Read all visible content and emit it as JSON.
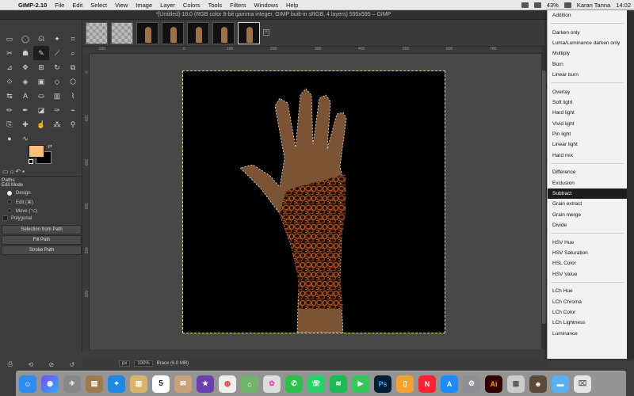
{
  "menubar": {
    "app_name": "GIMP-2.10",
    "items": [
      "File",
      "Edit",
      "Select",
      "View",
      "Image",
      "Layer",
      "Colors",
      "Tools",
      "Filters",
      "Windows",
      "Help"
    ],
    "battery": "43%",
    "user": "Karan Tanna",
    "time": "14:02"
  },
  "window": {
    "title": "*[Untitled]-18.0 (RGB color 8-bit gamma integer, GIMP built-in sRGB, 4 layers) 595x595 – GIMP"
  },
  "toolbox": {
    "foreground_color": "#ffbc7a",
    "background_color": "#000000",
    "tool_options": {
      "title": "Paths",
      "subtitle": "Edit Mode",
      "modes": [
        "Design",
        "Edit (⌘)",
        "Move (⌥)"
      ],
      "selected_mode": "Design",
      "polygonal_label": "Polygonal",
      "buttons": [
        "Selection from Path",
        "Fill Path",
        "Stroke Path"
      ]
    }
  },
  "rulers": {
    "h_ticks": [
      "-100",
      "0",
      "100",
      "200",
      "300",
      "400",
      "500",
      "600",
      "700"
    ],
    "v_ticks": [
      "0",
      "100",
      "200",
      "300",
      "400",
      "500"
    ]
  },
  "status": {
    "unit": "px",
    "zoom": "100%",
    "layer_info": "Brace (6.0 MB)"
  },
  "blend_menu": {
    "groups": [
      [
        "Addition"
      ],
      [
        "Darken only",
        "Luma/Luminance darken only",
        "Multiply",
        "Burn",
        "Linear burn"
      ],
      [
        "Overlay",
        "Soft light",
        "Hard light",
        "Vivid light",
        "Pin light",
        "Linear light",
        "Hard mix"
      ],
      [
        "Difference",
        "Exclusion",
        "Subtract",
        "Grain extract",
        "Grain merge",
        "Divide"
      ],
      [
        "HSV Hue",
        "HSV Saturation",
        "HSL Color",
        "HSV Value"
      ],
      [
        "LCh Hue",
        "LCh Chroma",
        "LCh Color",
        "LCh Lightness",
        "Luminance"
      ]
    ],
    "selected": "Subtract"
  },
  "dock": {
    "apps": [
      "finder-icon",
      "siri-icon",
      "launchpad-icon",
      "preview-icon",
      "safari-icon",
      "notes-icon",
      "calendar-icon",
      "mail-icon",
      "imovie-icon",
      "chrome-icon",
      "maps-icon",
      "photos-icon",
      "messages-icon",
      "whatsapp-icon",
      "spotify-icon",
      "facetime-icon",
      "photoshop-icon",
      "books-icon",
      "news-icon",
      "appstore-icon",
      "settings-icon",
      "illustrator-icon",
      "preview2-icon",
      "gimp-icon",
      "folder-icon",
      "trash-icon"
    ],
    "calendar_day": "5",
    "photoshop_label": "Ps",
    "illustrator_label": "Ai"
  }
}
